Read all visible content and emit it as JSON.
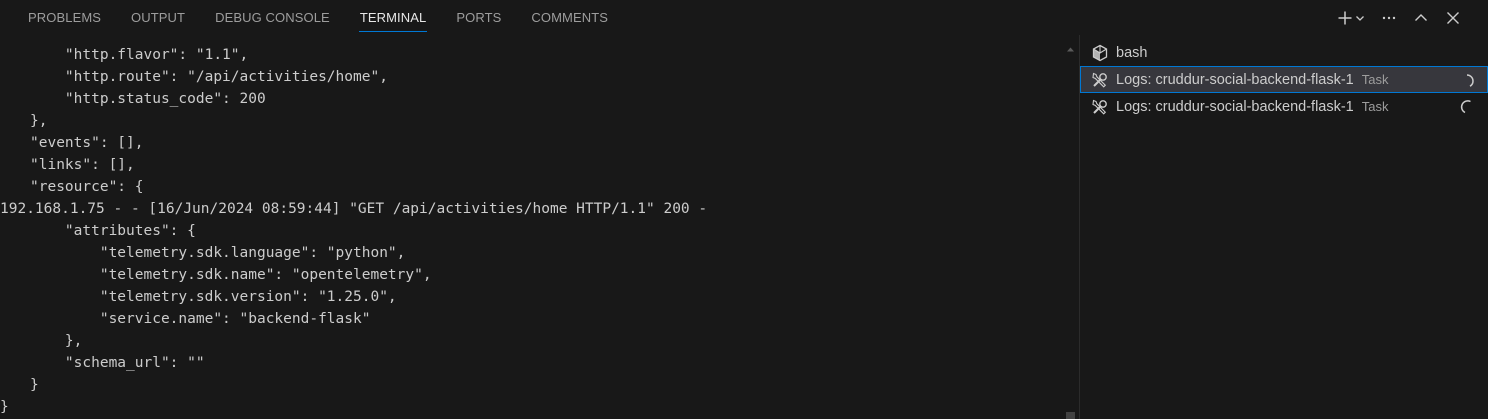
{
  "panel_tabs": [
    {
      "label": "PROBLEMS"
    },
    {
      "label": "OUTPUT"
    },
    {
      "label": "DEBUG CONSOLE"
    },
    {
      "label": "TERMINAL",
      "active": true
    },
    {
      "label": "PORTS"
    },
    {
      "label": "COMMENTS"
    }
  ],
  "actions": {
    "new_terminal_icon": "plus-icon",
    "launch_profile_icon": "chevron-down-icon",
    "more_icon": "ellipsis-icon",
    "maximize_icon": "chevron-up-icon",
    "close_icon": "close-icon"
  },
  "terminal": {
    "lines": [
      "    \"http.flavor\": \"1.1\",",
      "    \"http.route\": \"/api/activities/home\",",
      "    \"http.status_code\": 200",
      "},",
      "\"events\": [],",
      "\"links\": [],",
      "\"resource\": {",
      "192.168.1.75 - - [16/Jun/2024 08:59:44] \"GET /api/activities/home HTTP/1.1\" 200 -",
      "    \"attributes\": {",
      "        \"telemetry.sdk.language\": \"python\",",
      "        \"telemetry.sdk.name\": \"opentelemetry\",",
      "        \"telemetry.sdk.version\": \"1.25.0\",",
      "        \"service.name\": \"backend-flask\"",
      "    },",
      "    \"schema_url\": \"\"",
      "}",
      "}"
    ]
  },
  "terminal_list": [
    {
      "label": "bash",
      "icon": "terminal-box-icon",
      "description": ""
    },
    {
      "label": "Logs: cruddur-social-backend-flask-1",
      "icon": "tools-icon",
      "description": "Task",
      "status_icon": "loading-spinner-icon",
      "selected": true
    },
    {
      "label": "Logs: cruddur-social-backend-flask-1",
      "icon": "tools-icon",
      "description": "Task",
      "status_icon": "loading-spinner-icon"
    }
  ],
  "colors": {
    "background": "#181818",
    "text": "#cccccc",
    "muted": "#9d9d9d",
    "accent": "#0078d4",
    "selection": "#37373d"
  }
}
